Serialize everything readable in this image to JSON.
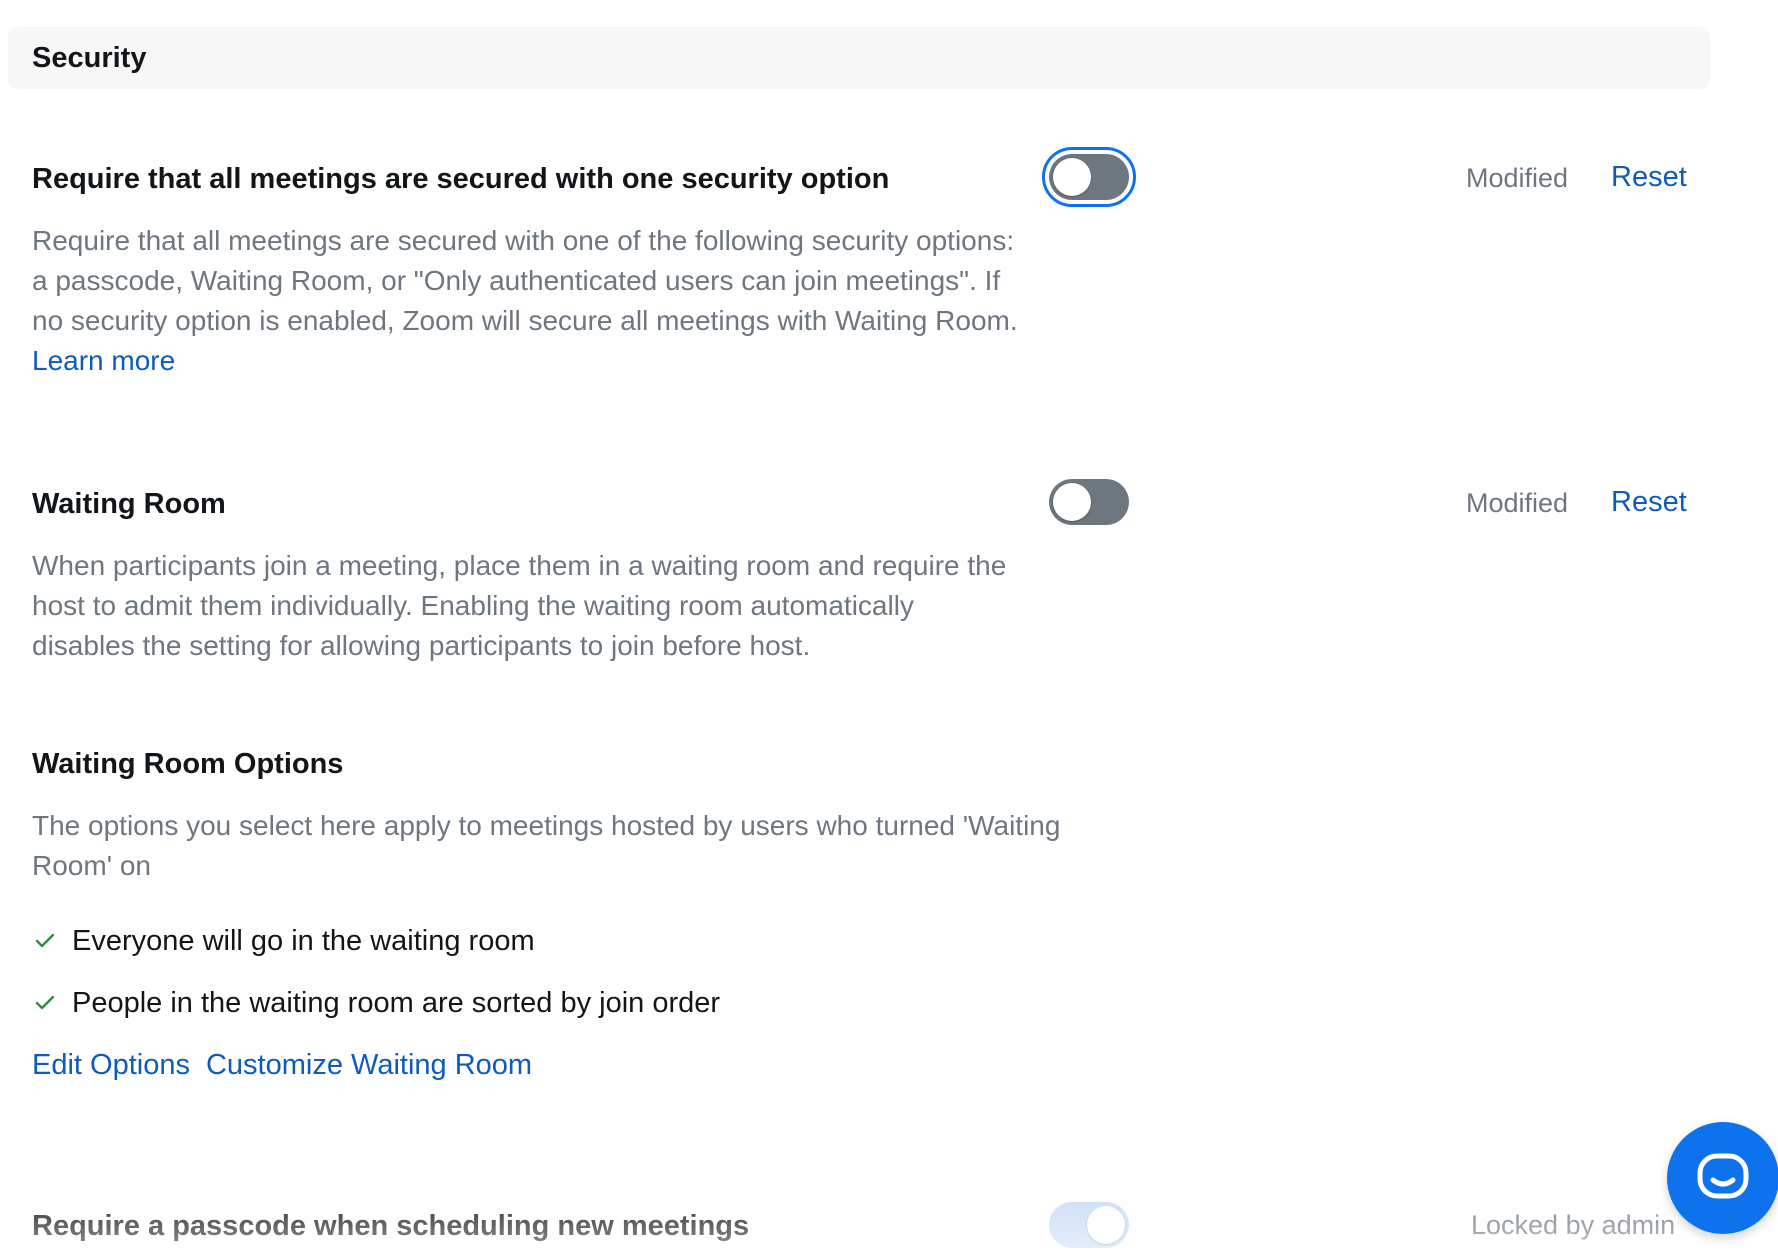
{
  "section": {
    "title": "Security"
  },
  "settings": [
    {
      "title": "Require that all meetings are secured with one security option",
      "description": "Require that all meetings are secured with one of the following security options: a passcode, Waiting Room, or \"Only authenticated users can join meetings\". If no security option is enabled, Zoom will secure all meetings with Waiting Room.",
      "link_label": "Learn more",
      "toggle_state": "off",
      "focused": true,
      "status": "Modified",
      "reset_label": "Reset"
    },
    {
      "title": "Waiting Room",
      "description": "When participants join a meeting, place them in a waiting room and require the host to admit them individually. Enabling the waiting room automatically disables the setting for allowing participants to join before host.",
      "toggle_state": "off",
      "status": "Modified",
      "reset_label": "Reset",
      "options": {
        "title": "Waiting Room Options",
        "description": "The options you select here apply to meetings hosted by users who turned 'Waiting Room' on",
        "items": [
          {
            "label": "Everyone will go in the waiting room",
            "icon": "check-icon"
          },
          {
            "label": "People in the waiting room are sorted by join order",
            "icon": "check-icon"
          }
        ],
        "edit_label": "Edit Options",
        "customize_label": "Customize Waiting Room"
      }
    },
    {
      "title": "Require a passcode when scheduling new meetings",
      "toggle_state": "on",
      "locked": true,
      "status": "Locked by admin"
    }
  ],
  "chat": {
    "icon": "chat-bubble-icon"
  },
  "colors": {
    "accent": "#0e72ed",
    "link": "#0e5bbd",
    "toggle_off": "#6e7680",
    "toggle_on_locked": "#c8dbf7",
    "check": "#2d8c3c",
    "header_bg": "#f7f7f8"
  }
}
